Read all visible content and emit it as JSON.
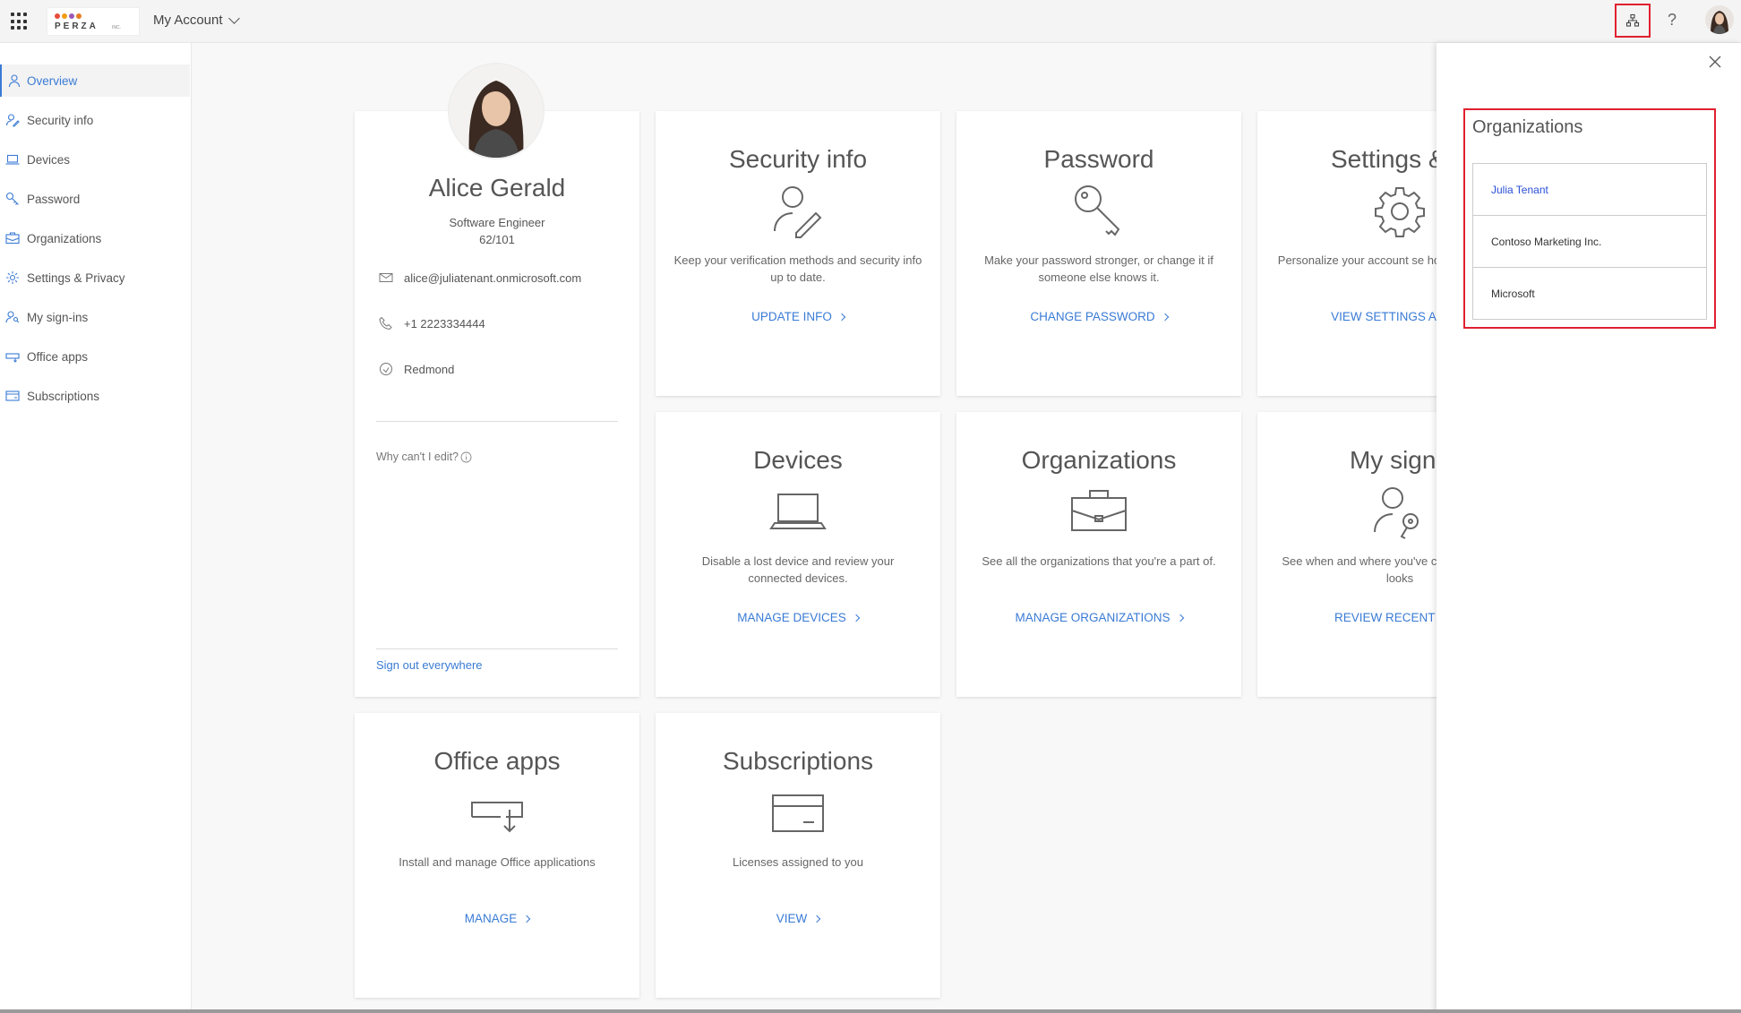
{
  "header": {
    "app_title": "My Account",
    "logo_text": "PERZA",
    "logo_suffix": "INC.",
    "help_glyph": "?"
  },
  "sidebar": {
    "items": [
      {
        "label": "Overview",
        "icon": "person-icon",
        "active": true
      },
      {
        "label": "Security info",
        "icon": "person-edit-icon",
        "active": false
      },
      {
        "label": "Devices",
        "icon": "laptop-icon",
        "active": false
      },
      {
        "label": "Password",
        "icon": "key-icon",
        "active": false
      },
      {
        "label": "Organizations",
        "icon": "briefcase-icon",
        "active": false
      },
      {
        "label": "Settings & Privacy",
        "icon": "gear-icon",
        "active": false
      },
      {
        "label": "My sign-ins",
        "icon": "person-key-icon",
        "active": false
      },
      {
        "label": "Office apps",
        "icon": "office-icon",
        "active": false
      },
      {
        "label": "Subscriptions",
        "icon": "card-icon",
        "active": false
      }
    ]
  },
  "profile": {
    "name": "Alice Gerald",
    "title": "Software Engineer",
    "office": "62/101",
    "email": "alice@juliatenant.onmicrosoft.com",
    "phone": "+1 2223334444",
    "location": "Redmond",
    "why_cant_edit": "Why can't I edit?",
    "sign_out": "Sign out everywhere"
  },
  "tiles": {
    "security": {
      "title": "Security info",
      "desc": "Keep your verification methods and security info up to date.",
      "link": "UPDATE INFO"
    },
    "password": {
      "title": "Password",
      "desc": "Make your password stronger, or change it if someone else knows it.",
      "link": "CHANGE PASSWORD"
    },
    "settings": {
      "title": "Settings & P",
      "desc": "Personalize your account se how your data is u",
      "link": "VIEW SETTINGS AND PI"
    },
    "devices": {
      "title": "Devices",
      "desc": "Disable a lost device and review your connected devices.",
      "link": "MANAGE DEVICES"
    },
    "organizations": {
      "title": "Organizations",
      "desc": "See all the organizations that you're a part of.",
      "link": "MANAGE ORGANIZATIONS"
    },
    "signins": {
      "title": "My sign-i",
      "desc": "See when and where you've check if anything looks",
      "link": "REVIEW RECENT ACTI"
    },
    "office": {
      "title": "Office apps",
      "desc": "Install and manage Office applications",
      "link": "MANAGE"
    },
    "subscriptions": {
      "title": "Subscriptions",
      "desc": "Licenses assigned to you",
      "link": "VIEW"
    }
  },
  "panel": {
    "title": "Organizations",
    "orgs": [
      {
        "name": "Julia Tenant",
        "active": true
      },
      {
        "name": "Contoso Marketing Inc.",
        "active": false
      },
      {
        "name": "Microsoft",
        "active": false
      }
    ]
  },
  "colors": {
    "accent": "#3a7bd5",
    "highlight_border": "#e02030",
    "active_org": "#2a4fd6"
  }
}
